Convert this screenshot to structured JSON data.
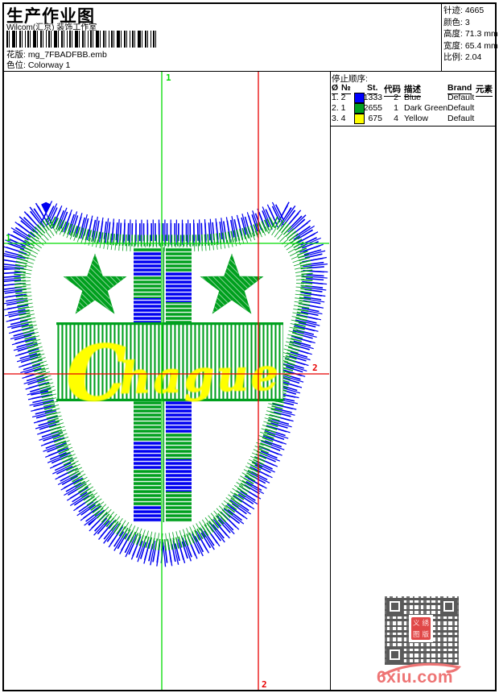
{
  "palette": {
    "stitch-blue": "#0000f0",
    "stitch-green": "#00a01e",
    "stitch-yellow": "#ffff00",
    "guide-green": "#00dc00",
    "guide-red": "#e80000",
    "qr-gray": "#595959",
    "stamp-red": "#e04848",
    "watermark-pink": "#ee7474"
  },
  "header": {
    "title": "生产作业图",
    "studio": "Wilcom(汇京) 装饰工作室",
    "pattern_label": "花版:",
    "pattern_value": "mg_7FBADFBB.emb",
    "colorway_label": "色位:",
    "colorway_value": "Colorway 1",
    "stats": [
      {
        "label": "针迹:",
        "value": "4665"
      },
      {
        "label": "颜色:",
        "value": "3"
      },
      {
        "label": "高度:",
        "value": "71.3 mm"
      },
      {
        "label": "宽度:",
        "value": "65.4 mm"
      },
      {
        "label": "比例:",
        "value": "2.04"
      }
    ]
  },
  "color_table": {
    "title": "停止顺序:",
    "columns": [
      "Ø",
      "№",
      "St.",
      "代码",
      "描述",
      "Brand",
      "元素"
    ],
    "rows": [
      {
        "seq": "1. 2",
        "color": "#0000ff",
        "stitches": "1333",
        "code": "2",
        "description": "Blue",
        "brand": "Default",
        "element": ""
      },
      {
        "seq": "2. 1",
        "color": "#00a020",
        "stitches": "2655",
        "code": "1",
        "description": "Dark Green",
        "brand": "Default",
        "element": ""
      },
      {
        "seq": "3. 4",
        "color": "#ffff00",
        "stitches": "675",
        "code": "4",
        "description": "Yellow",
        "brand": "Default",
        "element": ""
      }
    ]
  },
  "design": {
    "lettering_initial": "C",
    "lettering_rest": "hague"
  },
  "guides": {
    "v1_label": "1",
    "h1_label": "1",
    "h2_label": "2",
    "v2_label": "2"
  },
  "footer": {
    "watermark": "6xiu.com",
    "stamp_chars": [
      "义",
      "绣",
      "图",
      "版"
    ]
  }
}
